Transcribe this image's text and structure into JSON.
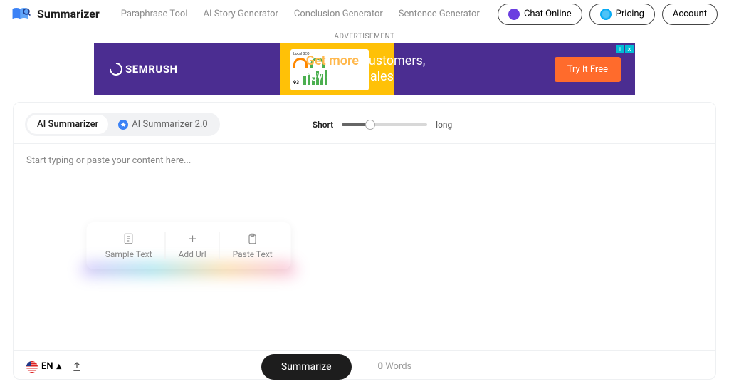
{
  "header": {
    "brand": "Summarizer",
    "nav": [
      "Paraphrase Tool",
      "AI Story Generator",
      "Conclusion Generator",
      "Sentence Generator"
    ],
    "chat_label": "Chat Online",
    "pricing_label": "Pricing",
    "account_label": "Account"
  },
  "ad": {
    "label": "ADVERTISEMENT",
    "brand": "SEMRUSH",
    "headline_gold": "Get more",
    "headline_rest1": " customers,",
    "headline_rest2": "reviews & sales",
    "cta": "Try It Free",
    "card_title": "Local SEO",
    "card_score": "93"
  },
  "tabs": {
    "active": "AI Summarizer",
    "inactive": "AI Summarizer 2.0"
  },
  "slider": {
    "short_label": "Short",
    "long_label": "long"
  },
  "input": {
    "placeholder": "Start typing or paste your content here...",
    "actions": [
      "Sample Text",
      "Add Url",
      "Paste Text"
    ]
  },
  "footer": {
    "lang": "EN",
    "summarize": "Summarize",
    "word_count_num": "0",
    "word_count_label": " Words"
  }
}
